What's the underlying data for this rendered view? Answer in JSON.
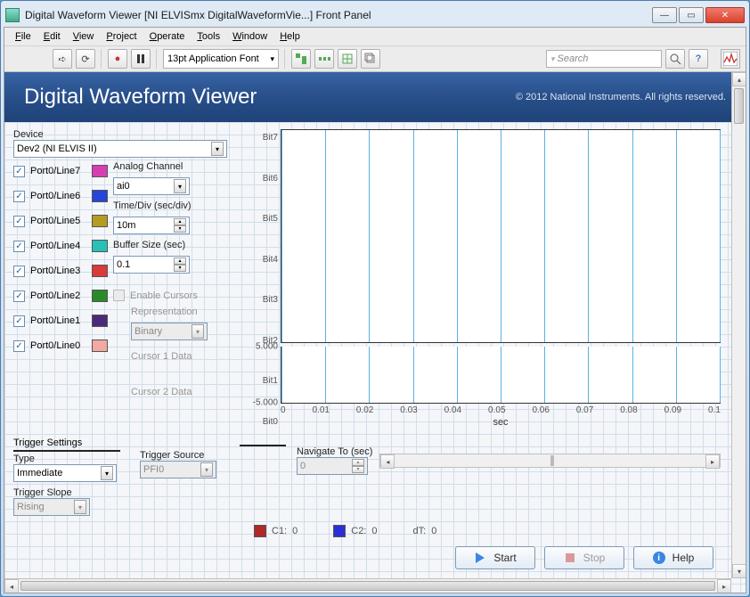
{
  "window": {
    "title": "Digital Waveform Viewer [NI ELVISmx DigitalWaveformVie...] Front Panel"
  },
  "menu": [
    "File",
    "Edit",
    "View",
    "Project",
    "Operate",
    "Tools",
    "Window",
    "Help"
  ],
  "toolbar": {
    "font": "13pt Application Font",
    "search_placeholder": "Search"
  },
  "header": {
    "title": "Digital Waveform Viewer",
    "copyright": "© 2012 National Instruments. All rights reserved."
  },
  "device": {
    "label": "Device",
    "value": "Dev2 (NI ELVIS II)"
  },
  "ports": [
    {
      "label": "Port0/Line7",
      "color": "#d63fb1",
      "checked": true
    },
    {
      "label": "Port0/Line6",
      "color": "#2546d6",
      "checked": true
    },
    {
      "label": "Port0/Line5",
      "color": "#b69a22",
      "checked": true
    },
    {
      "label": "Port0/Line4",
      "color": "#28c1b4",
      "checked": true
    },
    {
      "label": "Port0/Line3",
      "color": "#d93a3a",
      "checked": true
    },
    {
      "label": "Port0/Line2",
      "color": "#2a8a2a",
      "checked": true
    },
    {
      "label": "Port0/Line1",
      "color": "#4b2a7a",
      "checked": true
    },
    {
      "label": "Port0/Line0",
      "color": "#f2a9a2",
      "checked": true
    }
  ],
  "config": {
    "analog_label": "Analog Channel",
    "analog_value": "ai0",
    "timediv_label": "Time/Div (sec/div)",
    "timediv_value": "10m",
    "bufsize_label": "Buffer Size (sec)",
    "bufsize_value": "0.1",
    "enable_cursors": "Enable Cursors",
    "representation_label": "Representation",
    "representation_value": "Binary",
    "cursor1": "Cursor 1 Data",
    "cursor2": "Cursor 2 Data"
  },
  "trigger": {
    "title": "Trigger Settings",
    "type_label": "Type",
    "type_value": "Immediate",
    "source_label": "Trigger Source",
    "source_value": "PFI0",
    "slope_label": "Trigger Slope",
    "slope_value": "Rising"
  },
  "navigate": {
    "label": "Navigate To (sec)",
    "value": "0"
  },
  "cursors": {
    "c1_color": "#b02828",
    "c1_label": "C1:",
    "c1_value": "0",
    "c2_color": "#2a2fd4",
    "c2_label": "C2:",
    "c2_value": "0",
    "dt_label": "dT:",
    "dt_value": "0"
  },
  "buttons": {
    "start": "Start",
    "stop": "Stop",
    "help": "Help"
  },
  "chart_data": {
    "type": "line",
    "digital_bits": [
      "Bit7",
      "Bit6",
      "Bit5",
      "Bit4",
      "Bit3",
      "Bit2",
      "Bit1",
      "Bit0"
    ],
    "analog_ylim": [
      -5.0,
      5.0
    ],
    "x_ticks": [
      0,
      0.01,
      0.02,
      0.03,
      0.04,
      0.05,
      0.06,
      0.07,
      0.08,
      0.09,
      0.1
    ],
    "xlabel": "sec",
    "series": []
  }
}
